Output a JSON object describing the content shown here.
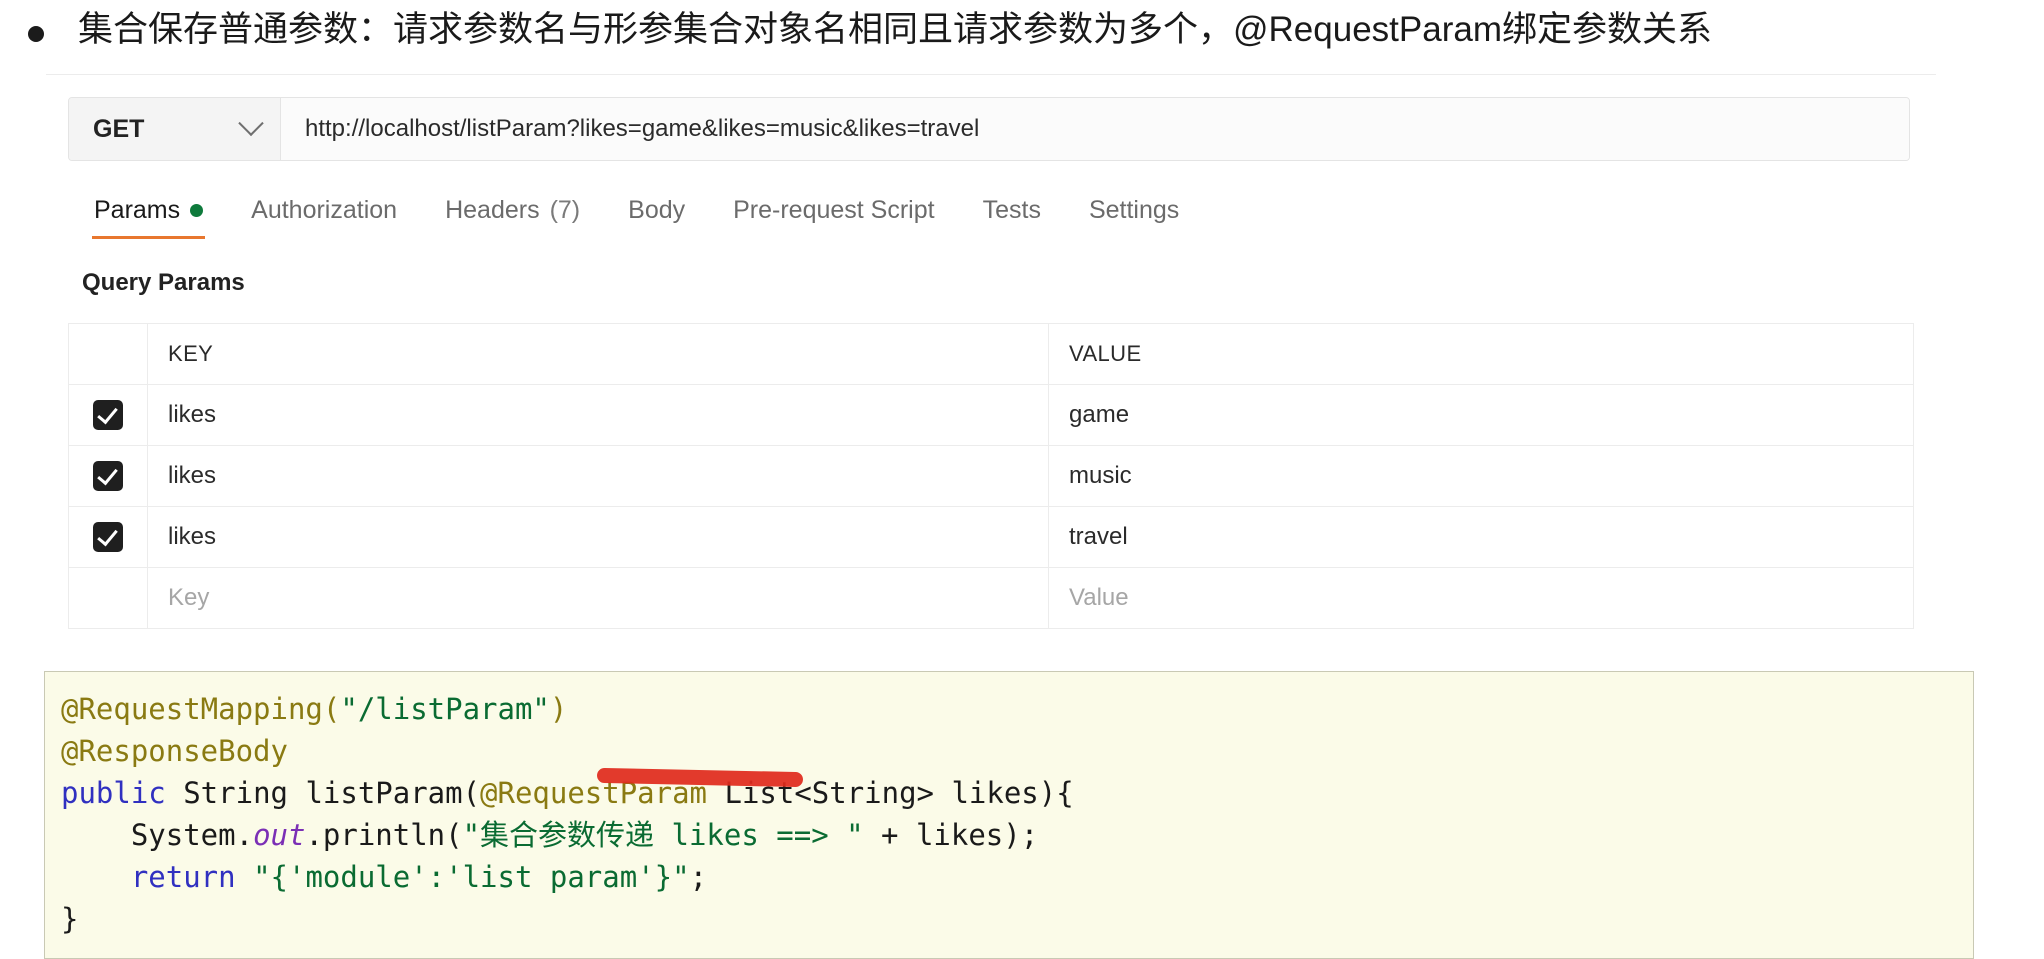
{
  "heading": {
    "bullet": "bullet-marker",
    "text": "集合保存普通参数：请求参数名与形参集合对象名相同且请求参数为多个，@RequestParam绑定参数关系"
  },
  "postman": {
    "request_bar": {
      "method": "GET",
      "method_chevron_icon": "chevron-down-icon",
      "url": "http://localhost/listParam?likes=game&likes=music&likes=travel",
      "url_placeholder": "Enter request URL"
    },
    "tabs": [
      {
        "label": "Params",
        "active": true,
        "dot": true,
        "count": ""
      },
      {
        "label": "Authorization",
        "active": false,
        "dot": false,
        "count": ""
      },
      {
        "label": "Headers",
        "active": false,
        "dot": false,
        "count": "(7)"
      },
      {
        "label": "Body",
        "active": false,
        "dot": false,
        "count": ""
      },
      {
        "label": "Pre-request Script",
        "active": false,
        "dot": false,
        "count": ""
      },
      {
        "label": "Tests",
        "active": false,
        "dot": false,
        "count": ""
      },
      {
        "label": "Settings",
        "active": false,
        "dot": false,
        "count": ""
      }
    ],
    "query_params": {
      "title": "Query Params",
      "columns": [
        "KEY",
        "VALUE"
      ],
      "rows": [
        {
          "checked": true,
          "key": "likes",
          "value": "game"
        },
        {
          "checked": true,
          "key": "likes",
          "value": "music"
        },
        {
          "checked": true,
          "key": "likes",
          "value": "travel"
        },
        {
          "checked": false,
          "key": "Key",
          "value": "Value",
          "placeholder": true
        }
      ]
    },
    "accent_color": "#e8772e",
    "dot_color": "#0e7a3c"
  },
  "code": {
    "language": "java",
    "annotation_color": "#e02b1d",
    "lines": [
      {
        "tokens": [
          {
            "t": "@RequestMapping(",
            "c": "ann"
          },
          {
            "t": "\"/listParam\"",
            "c": "str"
          },
          {
            "t": ")",
            "c": "ann"
          }
        ]
      },
      {
        "tokens": [
          {
            "t": "@ResponseBody",
            "c": "ann"
          }
        ]
      },
      {
        "tokens": [
          {
            "t": "public",
            "c": "kw"
          },
          {
            "t": " String listParam(",
            "c": "plain"
          },
          {
            "t": "@RequestParam",
            "c": "ann"
          },
          {
            "t": " List<String> likes){",
            "c": "plain"
          }
        ]
      },
      {
        "tokens": [
          {
            "t": "    System.",
            "c": "plain"
          },
          {
            "t": "out",
            "c": "field"
          },
          {
            "t": ".println(",
            "c": "plain"
          },
          {
            "t": "\"集合参数传递 likes ==> \"",
            "c": "str"
          },
          {
            "t": " + likes);",
            "c": "plain"
          }
        ]
      },
      {
        "tokens": [
          {
            "t": "    ",
            "c": "plain"
          },
          {
            "t": "return",
            "c": "kw"
          },
          {
            "t": " ",
            "c": "plain"
          },
          {
            "t": "\"{'module':'list param'}\"",
            "c": "str"
          },
          {
            "t": ";",
            "c": "plain"
          }
        ]
      },
      {
        "tokens": [
          {
            "t": "}",
            "c": "plain"
          }
        ]
      }
    ],
    "red_underline": "red-marker-underline-on-List-String"
  }
}
